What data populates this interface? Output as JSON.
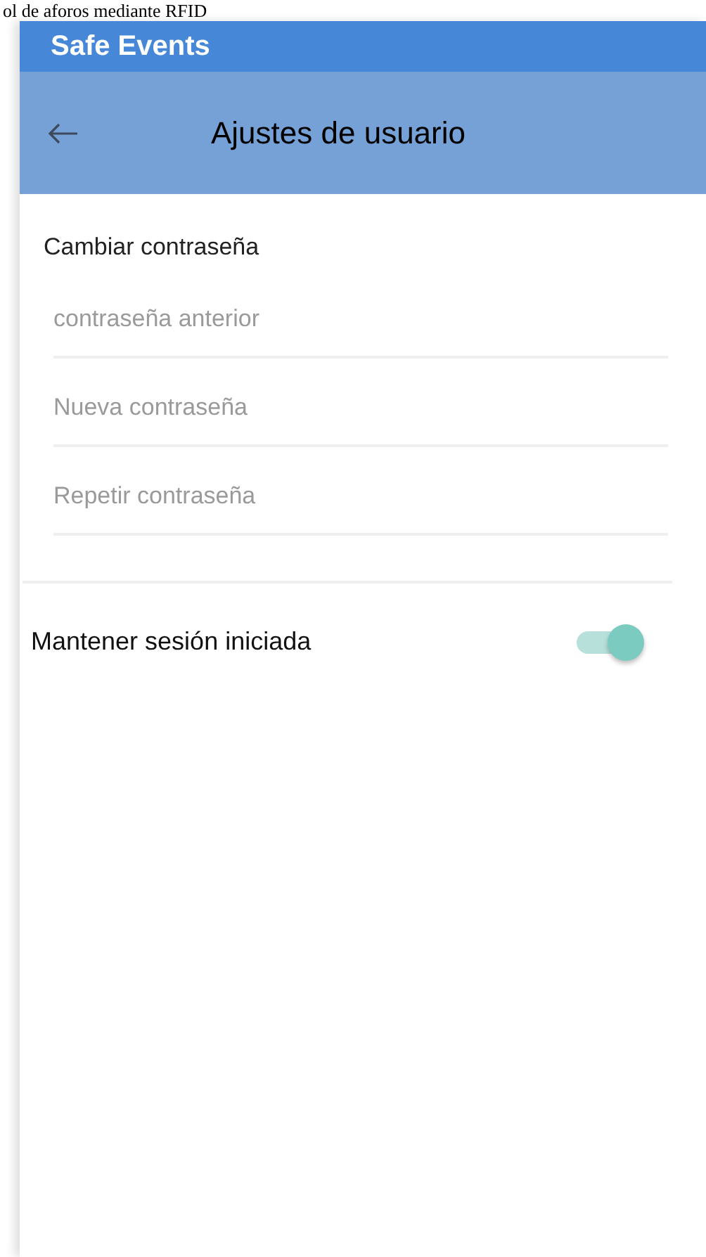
{
  "page_title": "ol de aforos mediante RFID",
  "app_name": "Safe Events",
  "toolbar": {
    "title": "Ajustes de usuario"
  },
  "password_section": {
    "heading": "Cambiar contraseña",
    "fields": [
      {
        "placeholder": "contraseña anterior"
      },
      {
        "placeholder": "Nueva contraseña"
      },
      {
        "placeholder": "Repetir contraseña"
      }
    ]
  },
  "settings": [
    {
      "label": "Mantener sesión iniciada",
      "on": true
    }
  ]
}
